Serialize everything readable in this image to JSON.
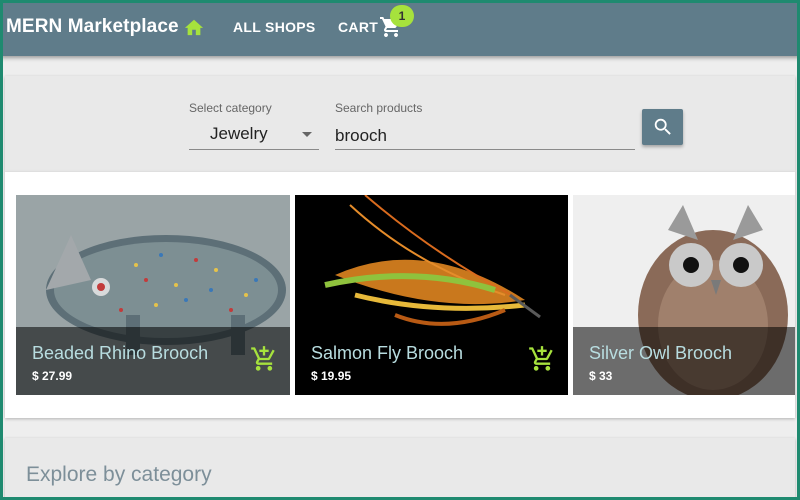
{
  "app": {
    "title": "MERN Marketplace",
    "nav": {
      "all_shops": "ALL SHOPS",
      "cart": "CART",
      "cart_count": "1"
    },
    "colors": {
      "appbar": "#5f7c8a",
      "accent": "#a6e23d",
      "home_icon": "#a6e23d"
    }
  },
  "search": {
    "category_label": "Select category",
    "category_value": "Jewelry",
    "query_label": "Search products",
    "query_value": "brooch",
    "search_icon": "search-icon"
  },
  "results": [
    {
      "name": "Beaded Rhino Brooch",
      "price": "$ 27.99",
      "icon": "add-shopping-cart-icon"
    },
    {
      "name": "Salmon Fly Brooch",
      "price": "$ 19.95",
      "icon": "add-shopping-cart-icon"
    },
    {
      "name": "Silver Owl Brooch",
      "price": "$ 33",
      "icon": "add-shopping-cart-icon"
    }
  ],
  "explore": {
    "title": "Explore by category"
  }
}
